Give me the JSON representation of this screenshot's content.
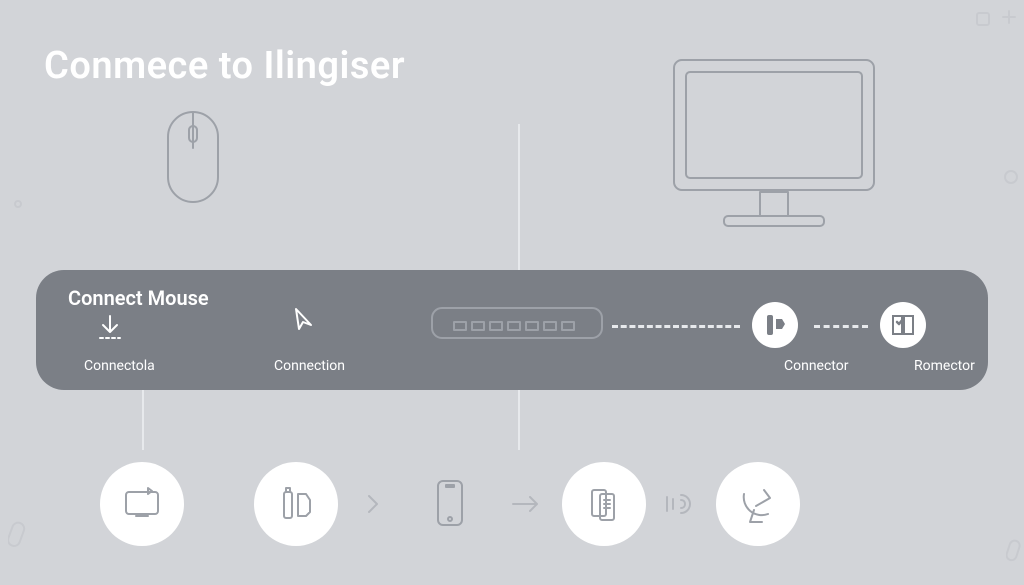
{
  "title": "Conmece to Ilingiser",
  "bar": {
    "heading": "Connect Mouse",
    "label_a": "Connectola",
    "label_b": "Connection",
    "label_c": "Connector",
    "label_d": "Romector"
  },
  "icons": {
    "mouse": "mouse-icon",
    "monitor": "monitor-icon",
    "download_arrow": "download-arrow-icon",
    "cursor": "cursor-icon",
    "hub": "hub-device-icon",
    "bar_circle_1": "connector-icon",
    "bar_circle_2": "checklist-book-icon",
    "bottom_1": "display-bookmark-icon",
    "bottom_2": "usb-bottle-icon",
    "bottom_3": "phone-icon",
    "bottom_4": "page-stack-icon",
    "bottom_5": "antenna-dish-icon",
    "sep_chevron": "chevron-right-icon",
    "sep_arrow": "arrow-right-icon",
    "sep_signal": "signal-waves-icon"
  },
  "colors": {
    "background": "#d2d4d8",
    "bar": "#7b7f86",
    "line": "#e7e9ec",
    "icon_stroke": "#9da1a8",
    "white": "#ffffff"
  }
}
